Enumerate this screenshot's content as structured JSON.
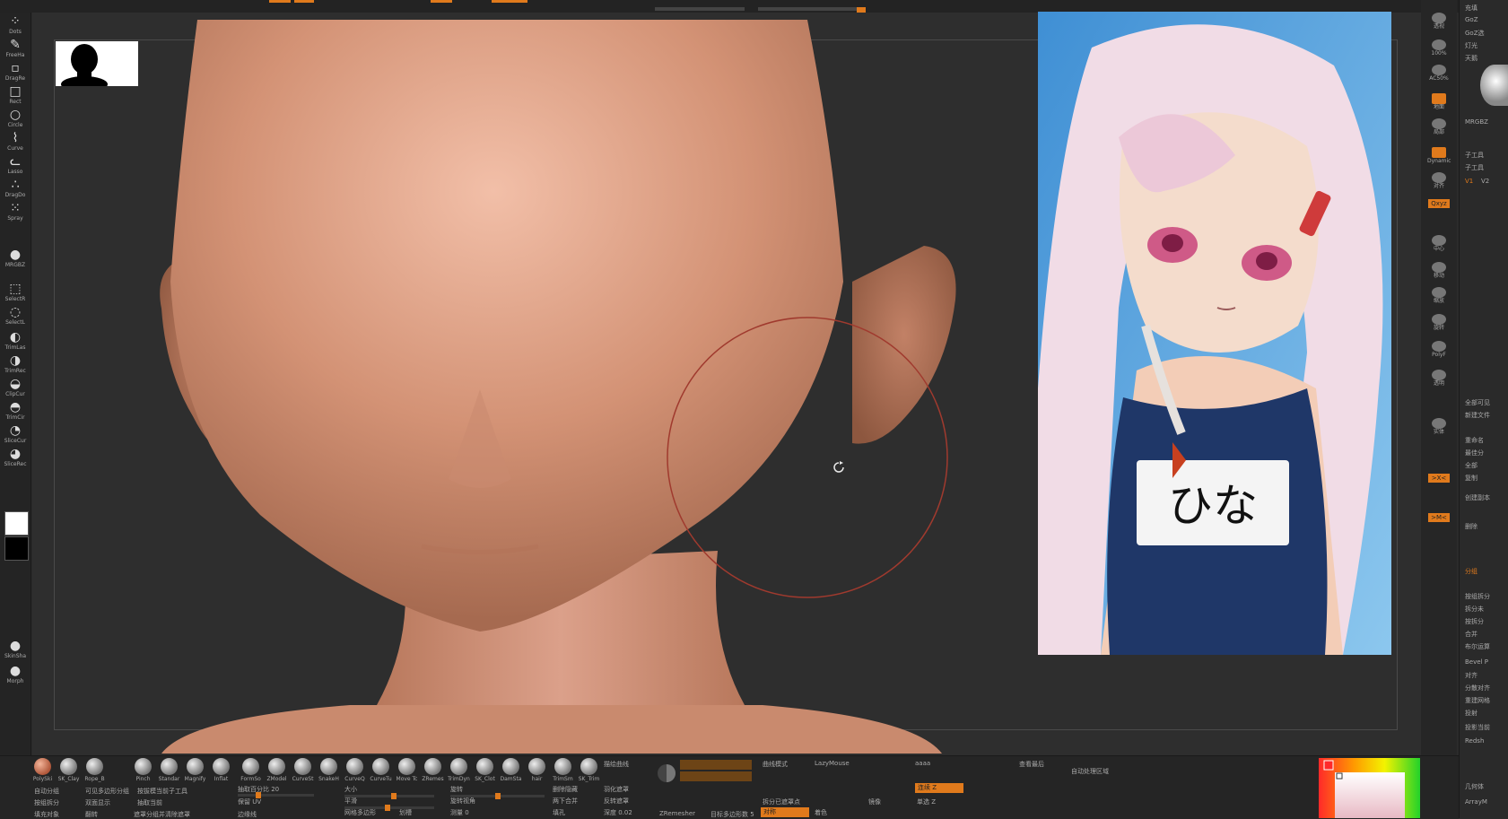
{
  "colors": {
    "accent": "#e07a1c",
    "panel": "#252525",
    "viewport": "#2e2e2e",
    "skin": "#d9977a"
  },
  "left_tools": [
    {
      "label": "Dots",
      "icon": "dots-icon"
    },
    {
      "label": "FreeHa",
      "icon": "freehand-icon"
    },
    {
      "label": "DragRe",
      "icon": "drag-rect-icon"
    },
    {
      "label": "Rect",
      "icon": "rect-icon"
    },
    {
      "label": "Circle",
      "icon": "circle-icon"
    },
    {
      "label": "Curve",
      "icon": "curve-icon"
    },
    {
      "label": "Lasso",
      "icon": "lasso-icon"
    },
    {
      "label": "DragDo",
      "icon": "drag-dot-icon"
    },
    {
      "label": "Spray",
      "icon": "spray-icon"
    },
    {
      "label": "MRGBZ",
      "icon": "mrgbz-icon"
    },
    {
      "label": "SelectR",
      "icon": "select-rect-icon"
    },
    {
      "label": "SelectL",
      "icon": "select-lasso-icon"
    },
    {
      "label": "TrimLas",
      "icon": "trim-lasso-icon"
    },
    {
      "label": "TrimRec",
      "icon": "trim-rect-icon"
    },
    {
      "label": "ClipCur",
      "icon": "clip-curve-icon"
    },
    {
      "label": "TrimCir",
      "icon": "trim-circle-icon"
    },
    {
      "label": "SliceCur",
      "icon": "slice-curve-icon"
    },
    {
      "label": "SliceRec",
      "icon": "slice-rect-icon"
    },
    {
      "label": "SkinSha",
      "icon": "skin-shade-icon"
    },
    {
      "label": "Morph",
      "icon": "morph-icon"
    }
  ],
  "reference_label": "ひな",
  "right_tools": [
    {
      "label": "透视",
      "icon": "perspective-icon",
      "on": false
    },
    {
      "label": "100%",
      "icon": "zoom-icon",
      "on": false
    },
    {
      "label": "AC50%",
      "icon": "ac-icon",
      "on": false
    },
    {
      "label": "地面",
      "icon": "floor-icon",
      "on": true
    },
    {
      "label": "局部",
      "icon": "local-icon",
      "on": false
    },
    {
      "label": "Dynamic",
      "icon": "dynamic-icon",
      "on": true
    },
    {
      "label": "对齐",
      "icon": "align-icon",
      "on": false
    },
    {
      "label": "中心",
      "icon": "center-icon",
      "on": false
    },
    {
      "label": "移动",
      "icon": "move-icon",
      "on": false
    },
    {
      "label": "缩放",
      "icon": "scale-icon",
      "on": false
    },
    {
      "label": "旋转",
      "icon": "rotate-icon",
      "on": false
    },
    {
      "label": "PolyF",
      "icon": "polyframe-icon",
      "on": false
    },
    {
      "label": "透明",
      "icon": "transparent-icon",
      "on": false
    },
    {
      "label": "实体",
      "icon": "solo-icon",
      "on": false
    }
  ],
  "right_tags": [
    "Qxyz",
    ">X<",
    ">M<"
  ],
  "side_list": [
    "充填",
    "GoZ",
    "GoZ选",
    "灯光",
    "天鹅",
    "MRGBZ",
    "子工具",
    "子工具",
    "V1",
    "V2",
    "全部可见",
    "新建文件",
    "重命名",
    "最佳分",
    "全部",
    "复制",
    "创建副本",
    "删除",
    "分组",
    "按组拆分",
    "拆分未",
    "按拆分",
    "合并",
    "布尔运算",
    "Bevel P",
    "对齐",
    "分散对齐",
    "重建网格",
    "投射",
    "投影当前",
    "Redsh",
    "几何体",
    "ArrayM"
  ],
  "brushes": [
    "PolySki",
    "SK_Clay",
    "Rope_B",
    "Pinch",
    "Standar",
    "Magnify",
    "Inflat",
    "FormSo",
    "ZModel",
    "CurveSt",
    "SnakeH",
    "CurveQ",
    "CurveTu",
    "Move Tc",
    "ZRemes",
    "TrimDyn",
    "SK_Clot",
    "DamSta",
    "hair",
    "TrimSm",
    "SK_Trim"
  ],
  "bottom_controls": {
    "group_visible": "自动分组",
    "group_masked": "可见多边形分组",
    "group_sub": "按拔模当前子工具",
    "group_split": "按组拆分",
    "double_show": "双面显示",
    "extract_current": "抽取当前",
    "fill_object": "填充对象",
    "flip": "翻转",
    "brush_plus": "遮罩分组并清除遮罩",
    "extract_label": "抽取百分比 20",
    "keep_uv": "保留 UV",
    "border": "边缘线",
    "size": "大小",
    "smooth": "平滑",
    "rotate": "旋转",
    "rotate_view": "旋转视角",
    "mesh_to_shape": "网格多边形",
    "unwrap": "划槽",
    "fill_holes": "删除隐藏",
    "merge_sub": "两下合并",
    "fill": "填孔",
    "spread": "羽化遮罩",
    "invert": "反转遮罩",
    "depth": "深度 0.02",
    "stroke_mode": "描绘曲线",
    "curve_mode": "曲线模式",
    "lazy_mouse": "LazyMouse",
    "zremesher": "ZRemesher",
    "target_poly": "目标多边形数 5",
    "mirror": "对称",
    "color": "着色",
    "aaaa": "aaaa",
    "view_recent": "查看最后",
    "auto_area": "自动处理区域",
    "z_button": "连续 Z",
    "single_z": "单选 Z",
    "split_hidden": "拆分已遮罩点",
    "mirror2": "镜像",
    "value": "测量 0"
  }
}
